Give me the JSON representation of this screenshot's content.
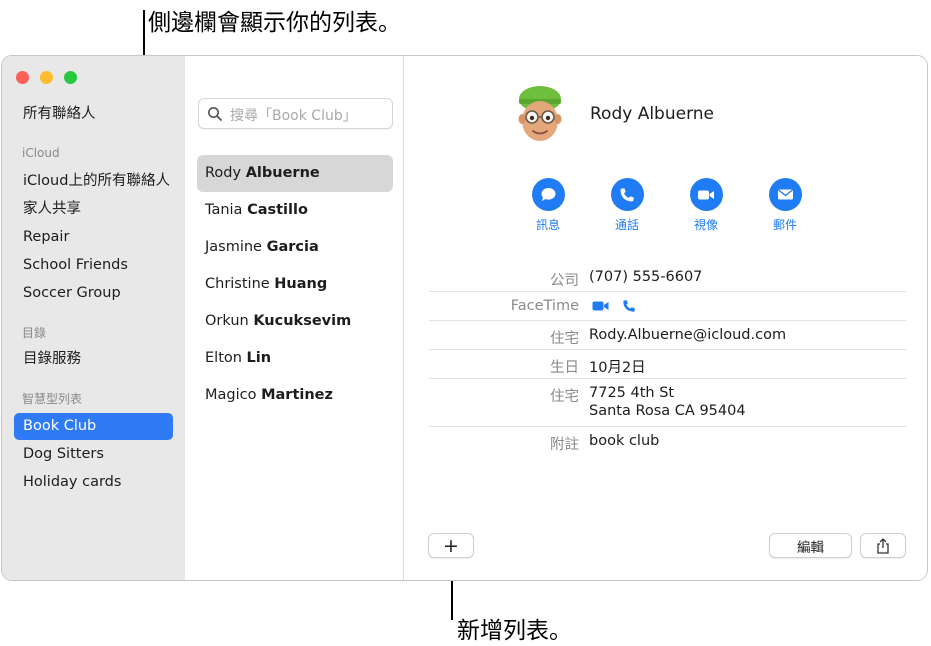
{
  "callouts": {
    "sidebar": "側邊欄會顯示你的列表。",
    "add_list": "新增列表。"
  },
  "sidebar": {
    "all_contacts": "所有聯絡人",
    "sections": [
      {
        "header": "iCloud",
        "items": [
          "iCloud上的所有聯絡人",
          "家人共享",
          "Repair",
          "School Friends",
          "Soccer Group"
        ]
      },
      {
        "header": "目錄",
        "items": [
          "目錄服務"
        ]
      },
      {
        "header": "智慧型列表",
        "items": [
          "Book Club",
          "Dog Sitters",
          "Holiday cards"
        ]
      }
    ],
    "selected": "Book Club"
  },
  "search": {
    "placeholder": "搜尋「Book Club」"
  },
  "contacts": [
    {
      "first": "Rody ",
      "last": "Albuerne",
      "selected": true
    },
    {
      "first": "Tania ",
      "last": "Castillo"
    },
    {
      "first": "Jasmine ",
      "last": "Garcia"
    },
    {
      "first": "Christine ",
      "last": "Huang"
    },
    {
      "first": "Orkun ",
      "last": "Kucuksevim"
    },
    {
      "first": "Elton ",
      "last": "Lin"
    },
    {
      "first": "Magico ",
      "last": "Martinez"
    }
  ],
  "detail": {
    "name": "Rody Albuerne",
    "actions": [
      {
        "label": "訊息",
        "icon": "message-icon"
      },
      {
        "label": "通話",
        "icon": "phone-icon"
      },
      {
        "label": "視像",
        "icon": "video-icon"
      },
      {
        "label": "郵件",
        "icon": "mail-icon"
      }
    ],
    "fields": [
      {
        "label": "公司",
        "value": "(707) 555-6607"
      },
      {
        "label": "FaceTime",
        "value": ""
      },
      {
        "label": "住宅",
        "value": "Rody.Albuerne@icloud.com"
      },
      {
        "label": "生日",
        "value": "10月2日"
      },
      {
        "label": "住宅",
        "value": "7725 4th St",
        "value2": "Santa Rosa CA 95404"
      },
      {
        "label": "附註",
        "value": "book club"
      }
    ]
  },
  "toolbar": {
    "add_label": "+",
    "edit_label": "編輯",
    "share_icon": "share-icon"
  },
  "colors": {
    "accent": "#1f7cf5",
    "selection": "#2f7bf5"
  }
}
